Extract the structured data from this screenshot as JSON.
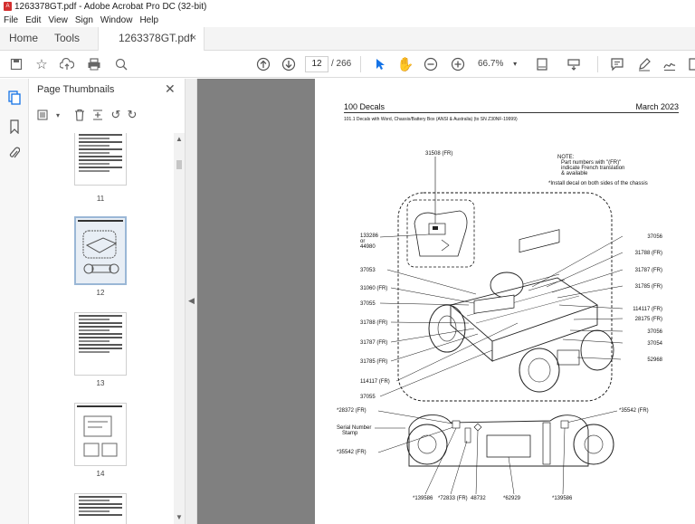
{
  "window": {
    "title": "1263378GT.pdf - Adobe Acrobat Pro DC (32-bit)"
  },
  "menu": [
    "File",
    "Edit",
    "View",
    "Sign",
    "Window",
    "Help"
  ],
  "tabs": {
    "home": "Home",
    "tools": "Tools",
    "document": "1263378GT.pdf",
    "close": "×"
  },
  "toolbar": {
    "page_current": "12",
    "page_total": "/ 266",
    "zoom": "66.7%"
  },
  "panel": {
    "title": "Page Thumbnails",
    "thumbnails": [
      {
        "num": "11",
        "selected": false
      },
      {
        "num": "12",
        "selected": true
      },
      {
        "num": "13",
        "selected": false
      },
      {
        "num": "14",
        "selected": false
      }
    ]
  },
  "page": {
    "header_left": "100 Decals",
    "header_right": "March 2023",
    "subtitle": "101.1 Decals with Word, Chassis/Battery Box (ANSI & Australia) (to SN Z30NF-19999)",
    "note_title": "NOTE:",
    "note_lines": [
      "Part numbers with \"(FR)\"",
      "indicate French translation",
      "& available"
    ],
    "install_note": "*Install decal on both sides of the chassis",
    "labels": {
      "top_center": "31508 (FR)",
      "left": [
        "133286",
        "or",
        "44980",
        "37053",
        "31060 (FR)",
        "37055",
        "31788 (FR)",
        "31787 (FR)",
        "31785 (FR)",
        "114117 (FR)",
        "37055"
      ],
      "right": [
        "37056",
        "31788 (FR)",
        "31787 (FR)",
        "31785 (FR)",
        "114117 (FR)",
        "28175 (FR)",
        "37056",
        "37054",
        "52968"
      ],
      "bottom_left": [
        "*28372 (FR)",
        "Serial Number",
        "Stamp",
        "*35542 (FR)"
      ],
      "bottom_right": [
        "*35542 (FR)"
      ],
      "bottom": [
        "*139586",
        "*72833 (FR)",
        "48732",
        "*62929",
        "*139586"
      ]
    }
  }
}
